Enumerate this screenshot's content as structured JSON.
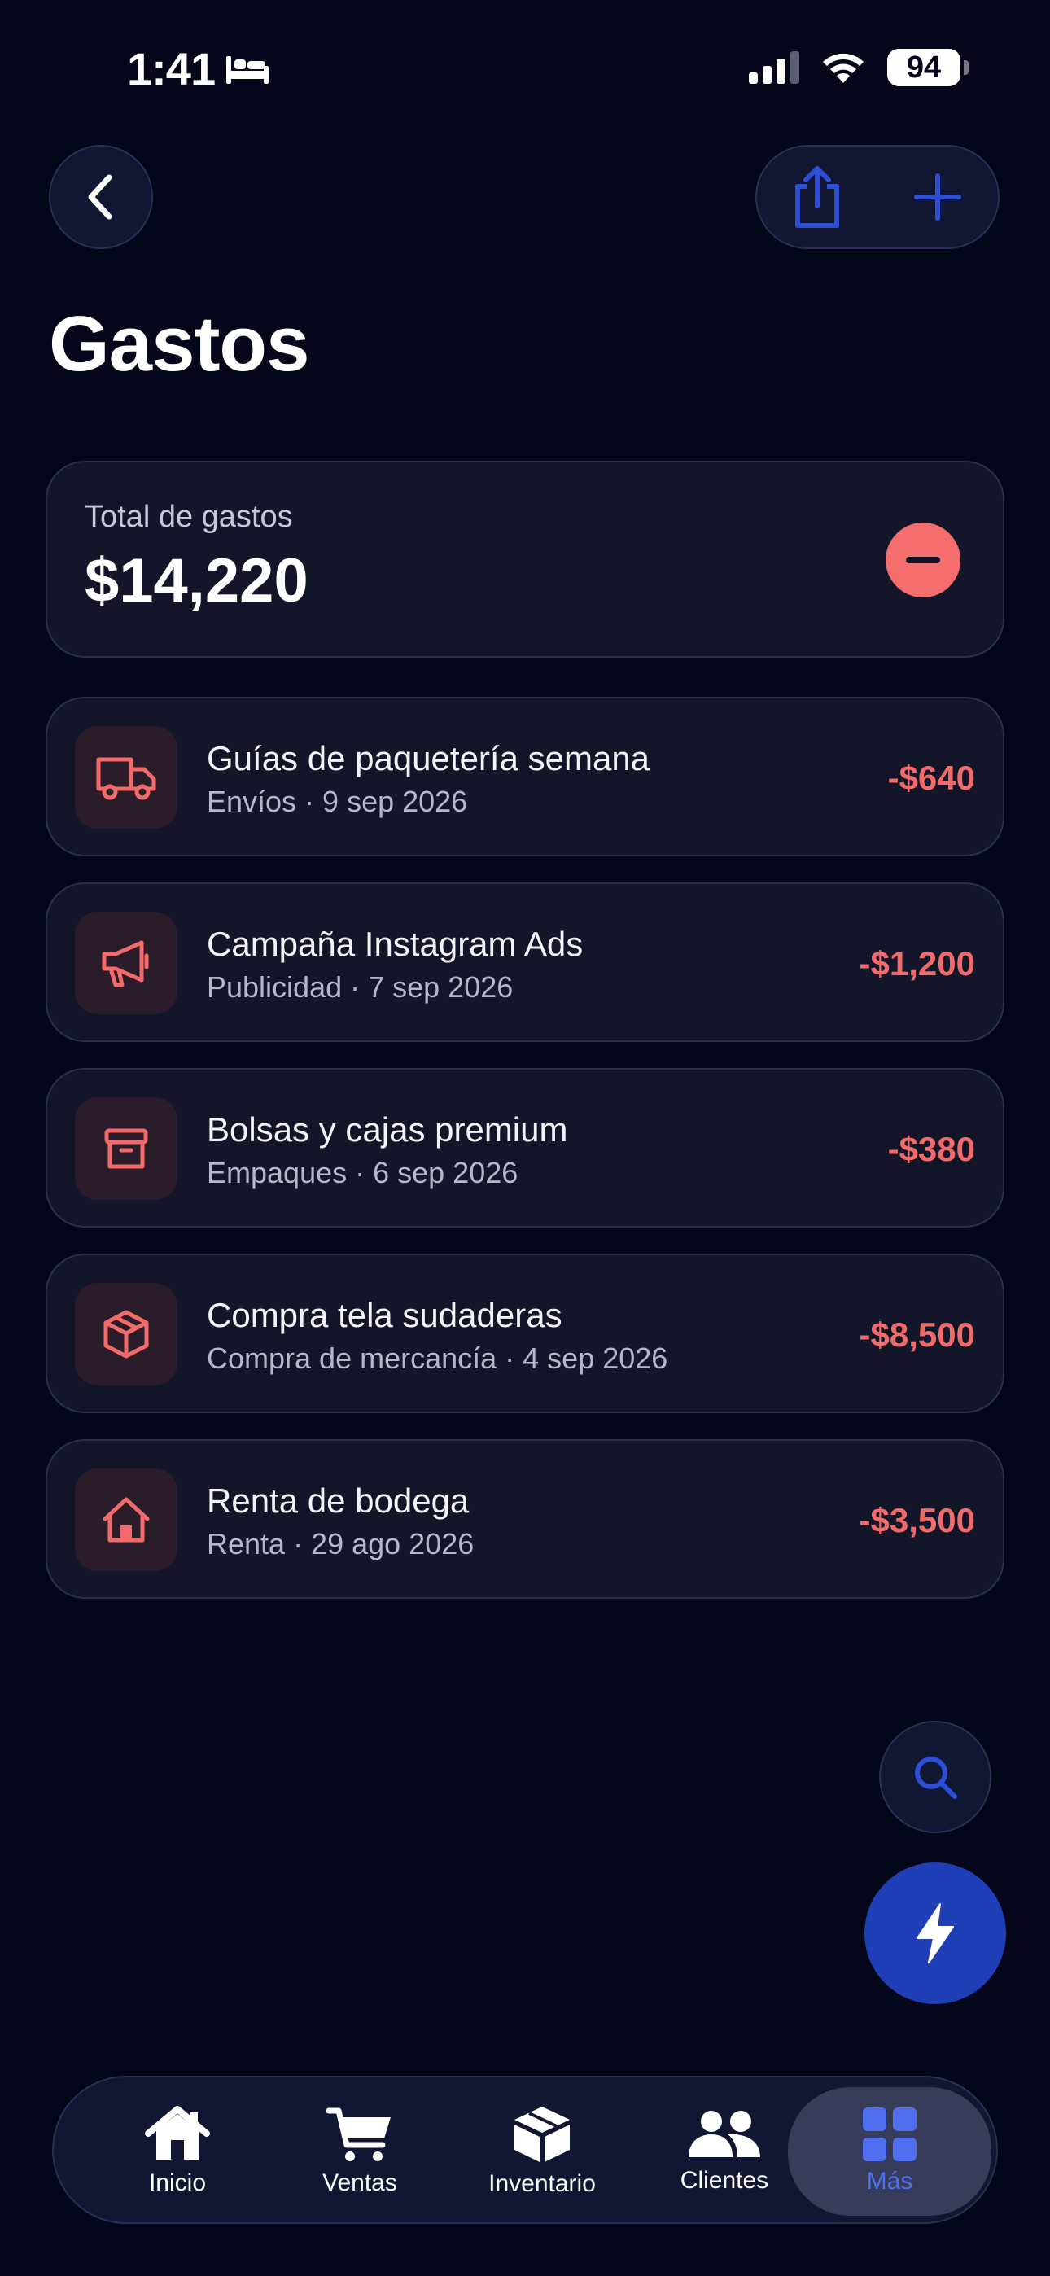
{
  "status": {
    "time": "1:41",
    "battery": "94"
  },
  "page": {
    "title": "Gastos"
  },
  "total": {
    "label": "Total de gastos",
    "value": "$14,220"
  },
  "expenses": [
    {
      "title": "Guías de paquetería semana",
      "subtitle": "Envíos · 9 sep 2026",
      "amount": "-$640",
      "icon": "truck-icon"
    },
    {
      "title": "Campaña Instagram Ads",
      "subtitle": "Publicidad · 7 sep 2026",
      "amount": "-$1,200",
      "icon": "megaphone-icon"
    },
    {
      "title": "Bolsas y cajas premium",
      "subtitle": "Empaques · 6 sep 2026",
      "amount": "-$380",
      "icon": "archive-box-icon"
    },
    {
      "title": "Compra tela sudaderas",
      "subtitle": "Compra de mercancía · 4 sep 2026",
      "amount": "-$8,500",
      "icon": "package-icon"
    },
    {
      "title": "Renta de bodega",
      "subtitle": "Renta · 29 ago 2026",
      "amount": "-$3,500",
      "icon": "house-icon"
    }
  ],
  "tabs": [
    {
      "label": "Inicio",
      "icon": "home-icon"
    },
    {
      "label": "Ventas",
      "icon": "cart-icon"
    },
    {
      "label": "Inventario",
      "icon": "cube-icon"
    },
    {
      "label": "Clientes",
      "icon": "people-icon"
    },
    {
      "label": "Más",
      "icon": "grid-icon",
      "active": true
    }
  ],
  "colors": {
    "background": "#04061a",
    "accent": "#1f3fb6",
    "expense": "#f26a6a",
    "active_tab": "#4f6ff0"
  }
}
